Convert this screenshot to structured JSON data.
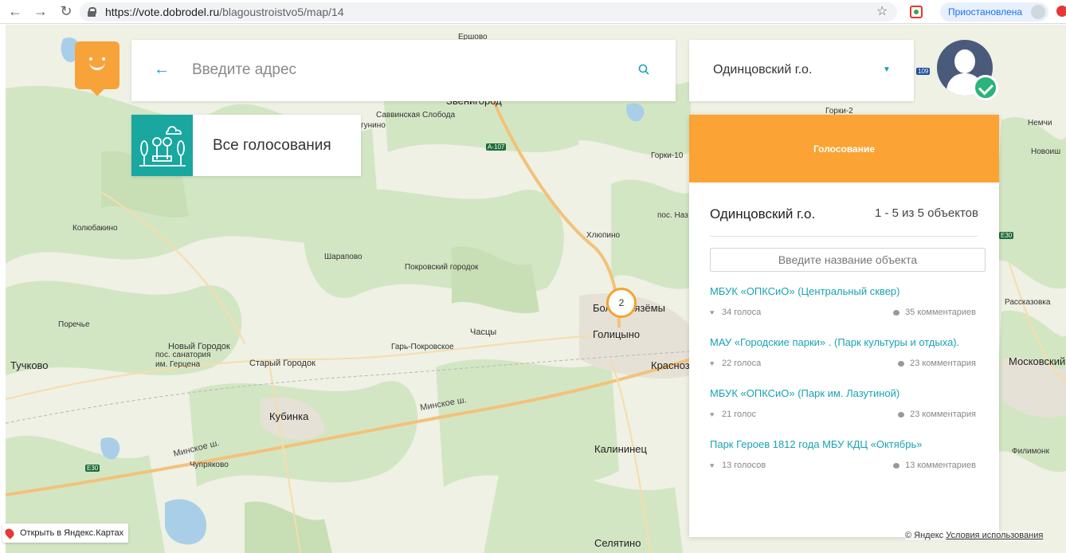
{
  "browser": {
    "url_host": "https://vote.dobrodel.ru",
    "url_path": "/blagoustroistvo5/map/14",
    "profile_label": "Приостановлена"
  },
  "search": {
    "placeholder": "Введите адрес"
  },
  "region_select": {
    "value": "Одинцовский г.о."
  },
  "all_votes": {
    "label": "Все голосования"
  },
  "panel": {
    "header": "Голосование",
    "region": "Одинцовский г.о.",
    "count": "1 - 5 из 5 объектов",
    "filter_placeholder": "Введите название объекта",
    "items": [
      {
        "title": "МБУК «ОПКСиО» (Центральный сквер)",
        "votes": "34 голоса",
        "comments": "35 комментариев"
      },
      {
        "title": "МАУ «Городские парки» . (Парк культуры и отдыха).",
        "votes": "22 голоса",
        "comments": "23 комментария"
      },
      {
        "title": "МБУК «ОПКСиО» (Парк им. Лазутиной)",
        "votes": "21 голос",
        "comments": "23 комментария"
      },
      {
        "title": "Парк Героев 1812 года МБУ КДЦ «Октябрь»",
        "votes": "13 голосов",
        "comments": "13 комментариев"
      }
    ]
  },
  "map": {
    "cluster_count": "2",
    "open_yandex_label": "Открыть в Яндекс.Картах",
    "copyright": "© Яндекс",
    "terms_label": "Условия использования",
    "places": {
      "zvenigorod": "Звенигород",
      "savvinskaya": "Саввинская Слобода",
      "gunino": "гунино",
      "koliubakino": "Колюбакино",
      "sharapovo": "Шарапово",
      "pokrovsky": "Покровский городок",
      "porechye": "Поречье",
      "novy_gorodok": "Новый Городок",
      "sanatoriya": "пос. санатория\nим. Герцена",
      "tuchkovo": "Тучково",
      "stary_gorodok": "Старый Городок",
      "chasy": "Часцы",
      "gar_pokrovskoe": "Гарь-Покровское",
      "kubinka": "Кубинка",
      "chupryakovo": "Чупряково",
      "gorki10": "Горки-10",
      "gorki2": "Горки-2",
      "khlyupino": "Хлюпино",
      "pos_naz": "пос. Наз",
      "b_vyazemy": "Больш Вязёмы",
      "golitsyno": "Голицыно",
      "krasnoz": "Краснозн",
      "kalininets": "Калининец",
      "selyatino": "Селятино",
      "nemchi": "Немчи",
      "novosh": "Новоиш",
      "rasskazovka": "Рассказовка",
      "moskovsky": "Московский",
      "filimonk": "Филимонк",
      "minskoe1": "Минское ш.",
      "minskoe2": "Минское ш.",
      "eshovo": "Ершово"
    },
    "shields": {
      "a107": "А-107",
      "e30_left": "Е30",
      "e30_right": "Е30",
      "m109": "109"
    }
  },
  "colors": {
    "accent_teal": "#17a3b4",
    "header_orange": "#fba334",
    "tile_teal": "#19a7a0"
  }
}
